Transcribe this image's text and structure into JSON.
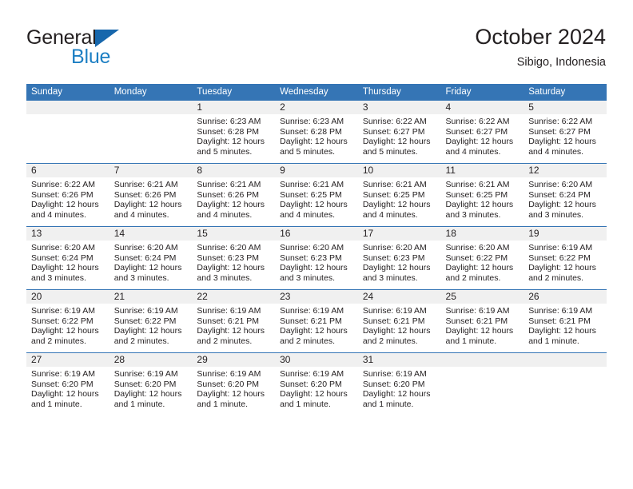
{
  "brand": {
    "name_top": "General",
    "name_bottom": "Blue",
    "accent_color": "#1767ac",
    "text_color": "#1d7fc3"
  },
  "header": {
    "title": "October 2024",
    "subtitle": "Sibigo, Indonesia",
    "header_bg": "#3575b5"
  },
  "weekday_headers": [
    "Sunday",
    "Monday",
    "Tuesday",
    "Wednesday",
    "Thursday",
    "Friday",
    "Saturday"
  ],
  "weeks": [
    [
      {
        "date": "",
        "empty": true
      },
      {
        "date": "",
        "empty": true
      },
      {
        "date": "1",
        "sunrise": "Sunrise: 6:23 AM",
        "sunset": "Sunset: 6:28 PM",
        "daylight_line1": "Daylight: 12 hours",
        "daylight_line2": "and 5 minutes."
      },
      {
        "date": "2",
        "sunrise": "Sunrise: 6:23 AM",
        "sunset": "Sunset: 6:28 PM",
        "daylight_line1": "Daylight: 12 hours",
        "daylight_line2": "and 5 minutes."
      },
      {
        "date": "3",
        "sunrise": "Sunrise: 6:22 AM",
        "sunset": "Sunset: 6:27 PM",
        "daylight_line1": "Daylight: 12 hours",
        "daylight_line2": "and 5 minutes."
      },
      {
        "date": "4",
        "sunrise": "Sunrise: 6:22 AM",
        "sunset": "Sunset: 6:27 PM",
        "daylight_line1": "Daylight: 12 hours",
        "daylight_line2": "and 4 minutes."
      },
      {
        "date": "5",
        "sunrise": "Sunrise: 6:22 AM",
        "sunset": "Sunset: 6:27 PM",
        "daylight_line1": "Daylight: 12 hours",
        "daylight_line2": "and 4 minutes."
      }
    ],
    [
      {
        "date": "6",
        "sunrise": "Sunrise: 6:22 AM",
        "sunset": "Sunset: 6:26 PM",
        "daylight_line1": "Daylight: 12 hours",
        "daylight_line2": "and 4 minutes."
      },
      {
        "date": "7",
        "sunrise": "Sunrise: 6:21 AM",
        "sunset": "Sunset: 6:26 PM",
        "daylight_line1": "Daylight: 12 hours",
        "daylight_line2": "and 4 minutes."
      },
      {
        "date": "8",
        "sunrise": "Sunrise: 6:21 AM",
        "sunset": "Sunset: 6:26 PM",
        "daylight_line1": "Daylight: 12 hours",
        "daylight_line2": "and 4 minutes."
      },
      {
        "date": "9",
        "sunrise": "Sunrise: 6:21 AM",
        "sunset": "Sunset: 6:25 PM",
        "daylight_line1": "Daylight: 12 hours",
        "daylight_line2": "and 4 minutes."
      },
      {
        "date": "10",
        "sunrise": "Sunrise: 6:21 AM",
        "sunset": "Sunset: 6:25 PM",
        "daylight_line1": "Daylight: 12 hours",
        "daylight_line2": "and 4 minutes."
      },
      {
        "date": "11",
        "sunrise": "Sunrise: 6:21 AM",
        "sunset": "Sunset: 6:25 PM",
        "daylight_line1": "Daylight: 12 hours",
        "daylight_line2": "and 3 minutes."
      },
      {
        "date": "12",
        "sunrise": "Sunrise: 6:20 AM",
        "sunset": "Sunset: 6:24 PM",
        "daylight_line1": "Daylight: 12 hours",
        "daylight_line2": "and 3 minutes."
      }
    ],
    [
      {
        "date": "13",
        "sunrise": "Sunrise: 6:20 AM",
        "sunset": "Sunset: 6:24 PM",
        "daylight_line1": "Daylight: 12 hours",
        "daylight_line2": "and 3 minutes."
      },
      {
        "date": "14",
        "sunrise": "Sunrise: 6:20 AM",
        "sunset": "Sunset: 6:24 PM",
        "daylight_line1": "Daylight: 12 hours",
        "daylight_line2": "and 3 minutes."
      },
      {
        "date": "15",
        "sunrise": "Sunrise: 6:20 AM",
        "sunset": "Sunset: 6:23 PM",
        "daylight_line1": "Daylight: 12 hours",
        "daylight_line2": "and 3 minutes."
      },
      {
        "date": "16",
        "sunrise": "Sunrise: 6:20 AM",
        "sunset": "Sunset: 6:23 PM",
        "daylight_line1": "Daylight: 12 hours",
        "daylight_line2": "and 3 minutes."
      },
      {
        "date": "17",
        "sunrise": "Sunrise: 6:20 AM",
        "sunset": "Sunset: 6:23 PM",
        "daylight_line1": "Daylight: 12 hours",
        "daylight_line2": "and 3 minutes."
      },
      {
        "date": "18",
        "sunrise": "Sunrise: 6:20 AM",
        "sunset": "Sunset: 6:22 PM",
        "daylight_line1": "Daylight: 12 hours",
        "daylight_line2": "and 2 minutes."
      },
      {
        "date": "19",
        "sunrise": "Sunrise: 6:19 AM",
        "sunset": "Sunset: 6:22 PM",
        "daylight_line1": "Daylight: 12 hours",
        "daylight_line2": "and 2 minutes."
      }
    ],
    [
      {
        "date": "20",
        "sunrise": "Sunrise: 6:19 AM",
        "sunset": "Sunset: 6:22 PM",
        "daylight_line1": "Daylight: 12 hours",
        "daylight_line2": "and 2 minutes."
      },
      {
        "date": "21",
        "sunrise": "Sunrise: 6:19 AM",
        "sunset": "Sunset: 6:22 PM",
        "daylight_line1": "Daylight: 12 hours",
        "daylight_line2": "and 2 minutes."
      },
      {
        "date": "22",
        "sunrise": "Sunrise: 6:19 AM",
        "sunset": "Sunset: 6:21 PM",
        "daylight_line1": "Daylight: 12 hours",
        "daylight_line2": "and 2 minutes."
      },
      {
        "date": "23",
        "sunrise": "Sunrise: 6:19 AM",
        "sunset": "Sunset: 6:21 PM",
        "daylight_line1": "Daylight: 12 hours",
        "daylight_line2": "and 2 minutes."
      },
      {
        "date": "24",
        "sunrise": "Sunrise: 6:19 AM",
        "sunset": "Sunset: 6:21 PM",
        "daylight_line1": "Daylight: 12 hours",
        "daylight_line2": "and 2 minutes."
      },
      {
        "date": "25",
        "sunrise": "Sunrise: 6:19 AM",
        "sunset": "Sunset: 6:21 PM",
        "daylight_line1": "Daylight: 12 hours",
        "daylight_line2": "and 1 minute."
      },
      {
        "date": "26",
        "sunrise": "Sunrise: 6:19 AM",
        "sunset": "Sunset: 6:21 PM",
        "daylight_line1": "Daylight: 12 hours",
        "daylight_line2": "and 1 minute."
      }
    ],
    [
      {
        "date": "27",
        "sunrise": "Sunrise: 6:19 AM",
        "sunset": "Sunset: 6:20 PM",
        "daylight_line1": "Daylight: 12 hours",
        "daylight_line2": "and 1 minute."
      },
      {
        "date": "28",
        "sunrise": "Sunrise: 6:19 AM",
        "sunset": "Sunset: 6:20 PM",
        "daylight_line1": "Daylight: 12 hours",
        "daylight_line2": "and 1 minute."
      },
      {
        "date": "29",
        "sunrise": "Sunrise: 6:19 AM",
        "sunset": "Sunset: 6:20 PM",
        "daylight_line1": "Daylight: 12 hours",
        "daylight_line2": "and 1 minute."
      },
      {
        "date": "30",
        "sunrise": "Sunrise: 6:19 AM",
        "sunset": "Sunset: 6:20 PM",
        "daylight_line1": "Daylight: 12 hours",
        "daylight_line2": "and 1 minute."
      },
      {
        "date": "31",
        "sunrise": "Sunrise: 6:19 AM",
        "sunset": "Sunset: 6:20 PM",
        "daylight_line1": "Daylight: 12 hours",
        "daylight_line2": "and 1 minute."
      },
      {
        "date": "",
        "empty": true
      },
      {
        "date": "",
        "empty": true
      }
    ]
  ]
}
